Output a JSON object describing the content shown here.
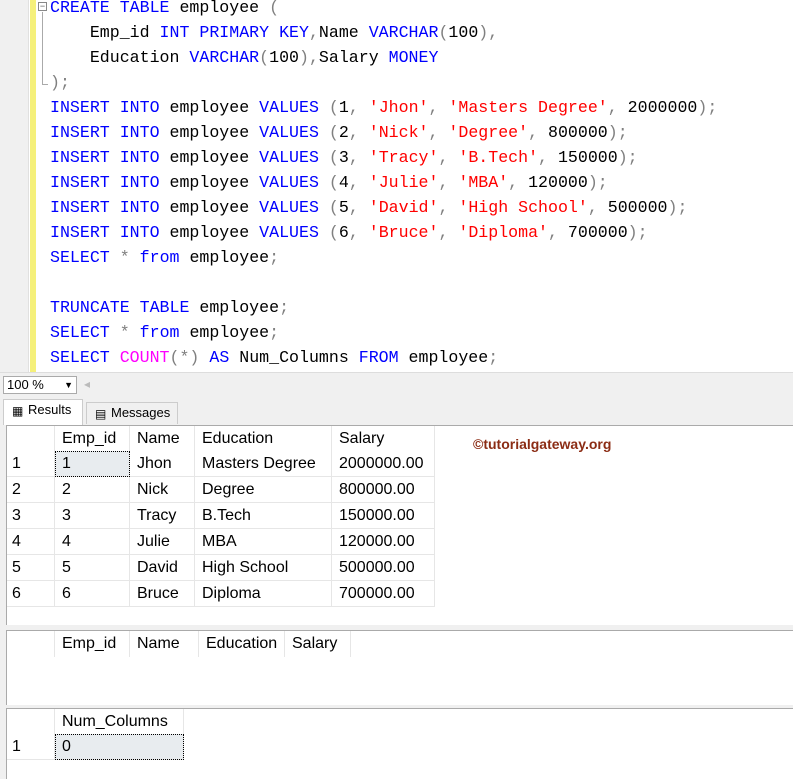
{
  "editor": {
    "lines": [
      [
        [
          "CREATE",
          "kw"
        ],
        [
          " ",
          "id"
        ],
        [
          "TABLE",
          "kw"
        ],
        [
          " employee ",
          "id"
        ],
        [
          "(",
          "pun"
        ]
      ],
      [
        [
          "    Emp_id ",
          "id"
        ],
        [
          "INT",
          "kw"
        ],
        [
          " ",
          "id"
        ],
        [
          "PRIMARY",
          "kw"
        ],
        [
          " ",
          "id"
        ],
        [
          "KEY",
          "kw"
        ],
        [
          ",",
          "pun"
        ],
        [
          "Name ",
          "id"
        ],
        [
          "VARCHAR",
          "kw"
        ],
        [
          "(",
          "pun"
        ],
        [
          "100",
          "id"
        ],
        [
          "),",
          "pun"
        ]
      ],
      [
        [
          "    Education ",
          "id"
        ],
        [
          "VARCHAR",
          "kw"
        ],
        [
          "(",
          "pun"
        ],
        [
          "100",
          "id"
        ],
        [
          ")",
          "pun"
        ],
        [
          ",",
          "pun"
        ],
        [
          "Salary ",
          "id"
        ],
        [
          "MONEY",
          "kw"
        ]
      ],
      [
        [
          ");",
          "pun"
        ]
      ],
      [
        [
          "INSERT",
          "kw"
        ],
        [
          " ",
          "id"
        ],
        [
          "INTO",
          "kw"
        ],
        [
          " employee ",
          "id"
        ],
        [
          "VALUES",
          "kw"
        ],
        [
          " ",
          "id"
        ],
        [
          "(",
          "pun"
        ],
        [
          "1",
          "id"
        ],
        [
          ", ",
          "pun"
        ],
        [
          "'Jhon'",
          "str"
        ],
        [
          ", ",
          "pun"
        ],
        [
          "'Masters Degree'",
          "str"
        ],
        [
          ", ",
          "pun"
        ],
        [
          "2000000",
          "id"
        ],
        [
          ");",
          "pun"
        ]
      ],
      [
        [
          "INSERT",
          "kw"
        ],
        [
          " ",
          "id"
        ],
        [
          "INTO",
          "kw"
        ],
        [
          " employee ",
          "id"
        ],
        [
          "VALUES",
          "kw"
        ],
        [
          " ",
          "id"
        ],
        [
          "(",
          "pun"
        ],
        [
          "2",
          "id"
        ],
        [
          ", ",
          "pun"
        ],
        [
          "'Nick'",
          "str"
        ],
        [
          ", ",
          "pun"
        ],
        [
          "'Degree'",
          "str"
        ],
        [
          ", ",
          "pun"
        ],
        [
          "800000",
          "id"
        ],
        [
          ");",
          "pun"
        ]
      ],
      [
        [
          "INSERT",
          "kw"
        ],
        [
          " ",
          "id"
        ],
        [
          "INTO",
          "kw"
        ],
        [
          " employee ",
          "id"
        ],
        [
          "VALUES",
          "kw"
        ],
        [
          " ",
          "id"
        ],
        [
          "(",
          "pun"
        ],
        [
          "3",
          "id"
        ],
        [
          ", ",
          "pun"
        ],
        [
          "'Tracy'",
          "str"
        ],
        [
          ", ",
          "pun"
        ],
        [
          "'B.Tech'",
          "str"
        ],
        [
          ", ",
          "pun"
        ],
        [
          "150000",
          "id"
        ],
        [
          ");",
          "pun"
        ]
      ],
      [
        [
          "INSERT",
          "kw"
        ],
        [
          " ",
          "id"
        ],
        [
          "INTO",
          "kw"
        ],
        [
          " employee ",
          "id"
        ],
        [
          "VALUES",
          "kw"
        ],
        [
          " ",
          "id"
        ],
        [
          "(",
          "pun"
        ],
        [
          "4",
          "id"
        ],
        [
          ", ",
          "pun"
        ],
        [
          "'Julie'",
          "str"
        ],
        [
          ", ",
          "pun"
        ],
        [
          "'MBA'",
          "str"
        ],
        [
          ", ",
          "pun"
        ],
        [
          "120000",
          "id"
        ],
        [
          ");",
          "pun"
        ]
      ],
      [
        [
          "INSERT",
          "kw"
        ],
        [
          " ",
          "id"
        ],
        [
          "INTO",
          "kw"
        ],
        [
          " employee ",
          "id"
        ],
        [
          "VALUES",
          "kw"
        ],
        [
          " ",
          "id"
        ],
        [
          "(",
          "pun"
        ],
        [
          "5",
          "id"
        ],
        [
          ", ",
          "pun"
        ],
        [
          "'David'",
          "str"
        ],
        [
          ", ",
          "pun"
        ],
        [
          "'High School'",
          "str"
        ],
        [
          ", ",
          "pun"
        ],
        [
          "500000",
          "id"
        ],
        [
          ");",
          "pun"
        ]
      ],
      [
        [
          "INSERT",
          "kw"
        ],
        [
          " ",
          "id"
        ],
        [
          "INTO",
          "kw"
        ],
        [
          " employee ",
          "id"
        ],
        [
          "VALUES",
          "kw"
        ],
        [
          " ",
          "id"
        ],
        [
          "(",
          "pun"
        ],
        [
          "6",
          "id"
        ],
        [
          ", ",
          "pun"
        ],
        [
          "'Bruce'",
          "str"
        ],
        [
          ", ",
          "pun"
        ],
        [
          "'Diploma'",
          "str"
        ],
        [
          ", ",
          "pun"
        ],
        [
          "700000",
          "id"
        ],
        [
          ");",
          "pun"
        ]
      ],
      [
        [
          "SELECT",
          "kw"
        ],
        [
          " ",
          "id"
        ],
        [
          "*",
          "pun"
        ],
        [
          " ",
          "id"
        ],
        [
          "from",
          "kw"
        ],
        [
          " employee",
          "id"
        ],
        [
          ";",
          "pun"
        ]
      ],
      [
        [
          "",
          "id"
        ]
      ],
      [
        [
          "TRUNCATE",
          "kw"
        ],
        [
          " ",
          "id"
        ],
        [
          "TABLE",
          "kw"
        ],
        [
          " employee",
          "id"
        ],
        [
          ";",
          "pun"
        ]
      ],
      [
        [
          "SELECT",
          "kw"
        ],
        [
          " ",
          "id"
        ],
        [
          "*",
          "pun"
        ],
        [
          " ",
          "id"
        ],
        [
          "from",
          "kw"
        ],
        [
          " employee",
          "id"
        ],
        [
          ";",
          "pun"
        ]
      ],
      [
        [
          "SELECT",
          "kw"
        ],
        [
          " ",
          "id"
        ],
        [
          "COUNT",
          "fn"
        ],
        [
          "(*)",
          "pun"
        ],
        [
          " ",
          "id"
        ],
        [
          "AS",
          "kw"
        ],
        [
          " Num_Columns ",
          "id"
        ],
        [
          "FROM",
          "kw"
        ],
        [
          " employee",
          "id"
        ],
        [
          ";",
          "pun"
        ]
      ]
    ]
  },
  "zoom": {
    "value": "100 %"
  },
  "tabs": {
    "results": "Results",
    "messages": "Messages"
  },
  "watermark": "©tutorialgateway.org",
  "grids": [
    {
      "columns": [
        "Emp_id",
        "Name",
        "Education",
        "Salary"
      ],
      "rows": [
        [
          "1",
          "1",
          "Jhon",
          "Masters Degree",
          "2000000.00"
        ],
        [
          "2",
          "2",
          "Nick",
          "Degree",
          "800000.00"
        ],
        [
          "3",
          "3",
          "Tracy",
          "B.Tech",
          "150000.00"
        ],
        [
          "4",
          "4",
          "Julie",
          "MBA",
          "120000.00"
        ],
        [
          "5",
          "5",
          "David",
          "High School",
          "500000.00"
        ],
        [
          "6",
          "6",
          "Bruce",
          "Diploma",
          "700000.00"
        ]
      ]
    },
    {
      "columns": [
        "Emp_id",
        "Name",
        "Education",
        "Salary"
      ],
      "rows": []
    },
    {
      "columns": [
        "Num_Columns"
      ],
      "rows": [
        [
          "1",
          "0"
        ]
      ]
    }
  ]
}
